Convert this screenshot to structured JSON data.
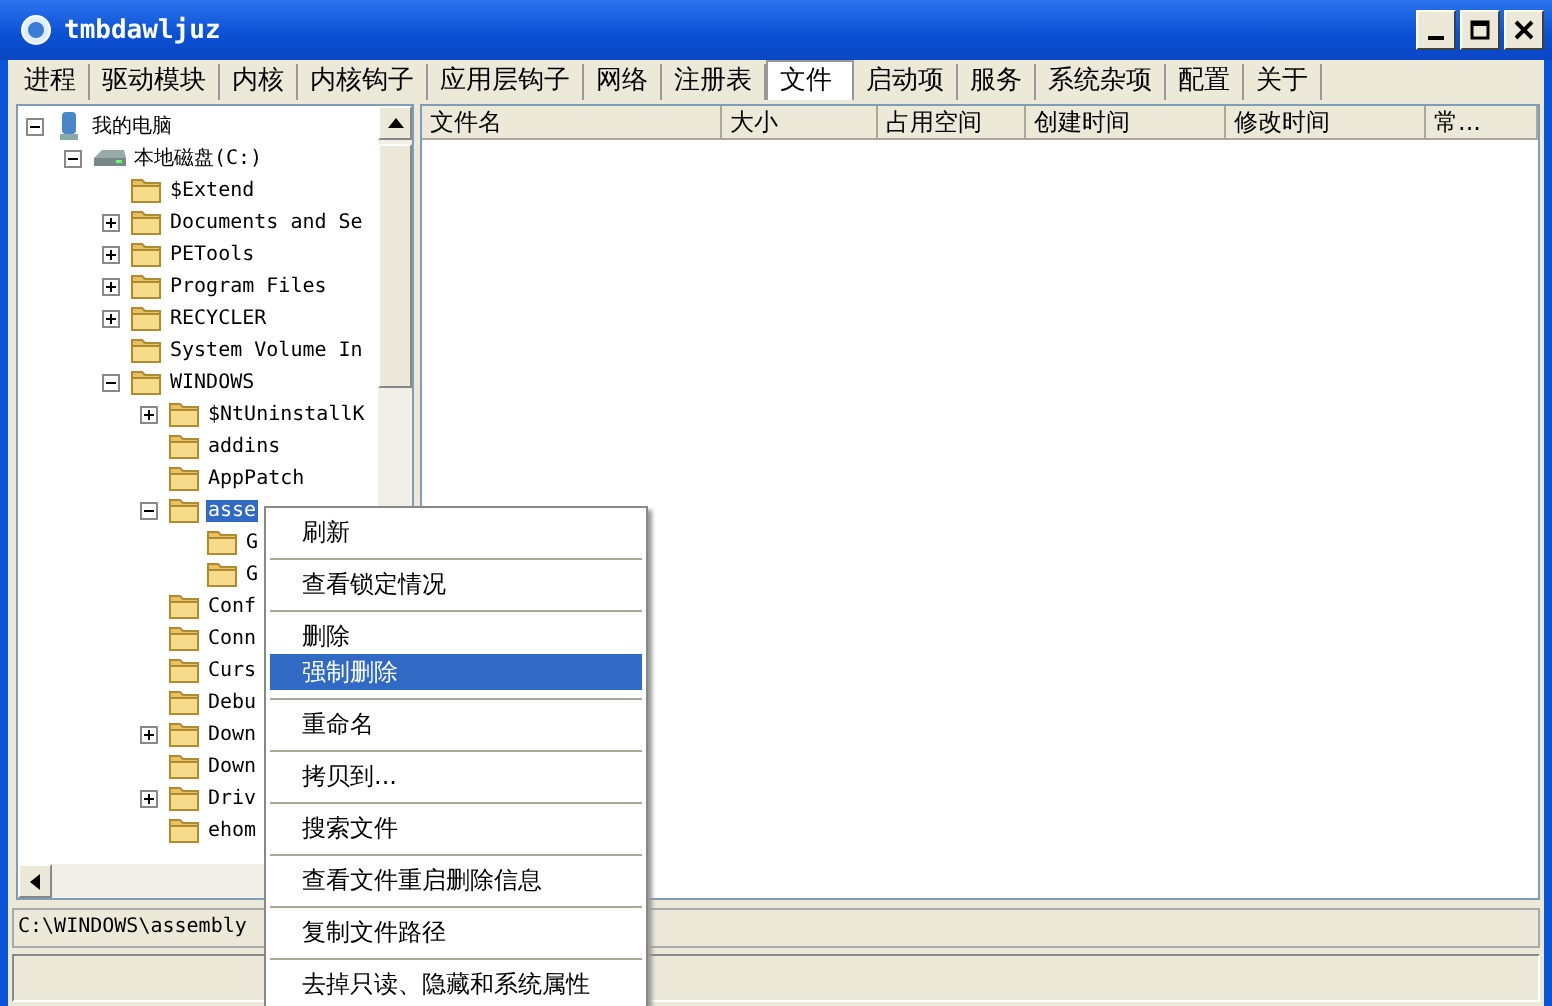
{
  "window": {
    "title": "tmbdawljuz"
  },
  "tabs": [
    {
      "label": "进程",
      "selected": false
    },
    {
      "label": "驱动模块",
      "selected": false
    },
    {
      "label": "内核",
      "selected": false
    },
    {
      "label": "内核钩子",
      "selected": false
    },
    {
      "label": "应用层钩子",
      "selected": false
    },
    {
      "label": "网络",
      "selected": false
    },
    {
      "label": "注册表",
      "selected": false
    },
    {
      "label": "文件",
      "selected": true
    },
    {
      "label": "启动项",
      "selected": false
    },
    {
      "label": "服务",
      "selected": false
    },
    {
      "label": "系统杂项",
      "selected": false
    },
    {
      "label": "配置",
      "selected": false
    },
    {
      "label": "关于",
      "selected": false
    }
  ],
  "tree": [
    {
      "label": "我的电脑",
      "kind": "computer",
      "expanded": true,
      "selected": false,
      "children": [
        {
          "label": "本地磁盘(C:)",
          "kind": "drive",
          "expanded": true,
          "selected": false,
          "children": [
            {
              "label": "$Extend",
              "kind": "folder",
              "selected": false
            },
            {
              "label": "Documents and Se",
              "kind": "folder",
              "expanded": false,
              "selected": false
            },
            {
              "label": "PETools",
              "kind": "folder",
              "expanded": false,
              "selected": false
            },
            {
              "label": "Program Files",
              "kind": "folder",
              "expanded": false,
              "selected": false
            },
            {
              "label": "RECYCLER",
              "kind": "folder",
              "expanded": false,
              "selected": false
            },
            {
              "label": "System Volume In",
              "kind": "folder",
              "selected": false
            },
            {
              "label": "WINDOWS",
              "kind": "folder",
              "expanded": true,
              "selected": false,
              "children": [
                {
                  "label": "$NtUninstallK",
                  "kind": "folder",
                  "expanded": false,
                  "selected": false
                },
                {
                  "label": "addins",
                  "kind": "folder",
                  "selected": false
                },
                {
                  "label": "AppPatch",
                  "kind": "folder",
                  "selected": false
                },
                {
                  "label": "asse",
                  "kind": "folder",
                  "expanded": true,
                  "selected": true,
                  "children": [
                    {
                      "label": "G",
                      "kind": "folder",
                      "selected": false
                    },
                    {
                      "label": "G",
                      "kind": "folder",
                      "selected": false
                    }
                  ]
                },
                {
                  "label": "Conf",
                  "kind": "folder",
                  "selected": false
                },
                {
                  "label": "Conn",
                  "kind": "folder",
                  "selected": false
                },
                {
                  "label": "Curs",
                  "kind": "folder",
                  "selected": false
                },
                {
                  "label": "Debu",
                  "kind": "folder",
                  "selected": false
                },
                {
                  "label": "Down",
                  "kind": "folder",
                  "expanded": false,
                  "selected": false
                },
                {
                  "label": "Down",
                  "kind": "folder",
                  "selected": false
                },
                {
                  "label": "Driv",
                  "kind": "folder",
                  "expanded": false,
                  "selected": false
                },
                {
                  "label": "ehom",
                  "kind": "folder",
                  "selected": false
                }
              ]
            }
          ]
        }
      ]
    }
  ],
  "file_table": {
    "columns": [
      "文件名",
      "大小",
      "占用空间",
      "创建时间",
      "修改时间",
      "常..."
    ]
  },
  "status_bar": {
    "path": "C:\\WINDOWS\\assembly"
  },
  "context_menu": {
    "groups": [
      [
        {
          "label": "刷新",
          "selected": false
        }
      ],
      [
        {
          "label": "查看锁定情况",
          "selected": false
        }
      ],
      [
        {
          "label": "删除",
          "selected": false
        },
        {
          "label": "强制删除",
          "selected": true
        }
      ],
      [
        {
          "label": "重命名",
          "selected": false
        }
      ],
      [
        {
          "label": "拷贝到...",
          "selected": false
        }
      ],
      [
        {
          "label": "搜索文件",
          "selected": false
        }
      ],
      [
        {
          "label": "查看文件重启删除信息",
          "selected": false
        }
      ],
      [
        {
          "label": "复制文件路径",
          "selected": false
        }
      ],
      [
        {
          "label": "去掉只读、隐藏和系统属性",
          "selected": false
        }
      ]
    ]
  }
}
